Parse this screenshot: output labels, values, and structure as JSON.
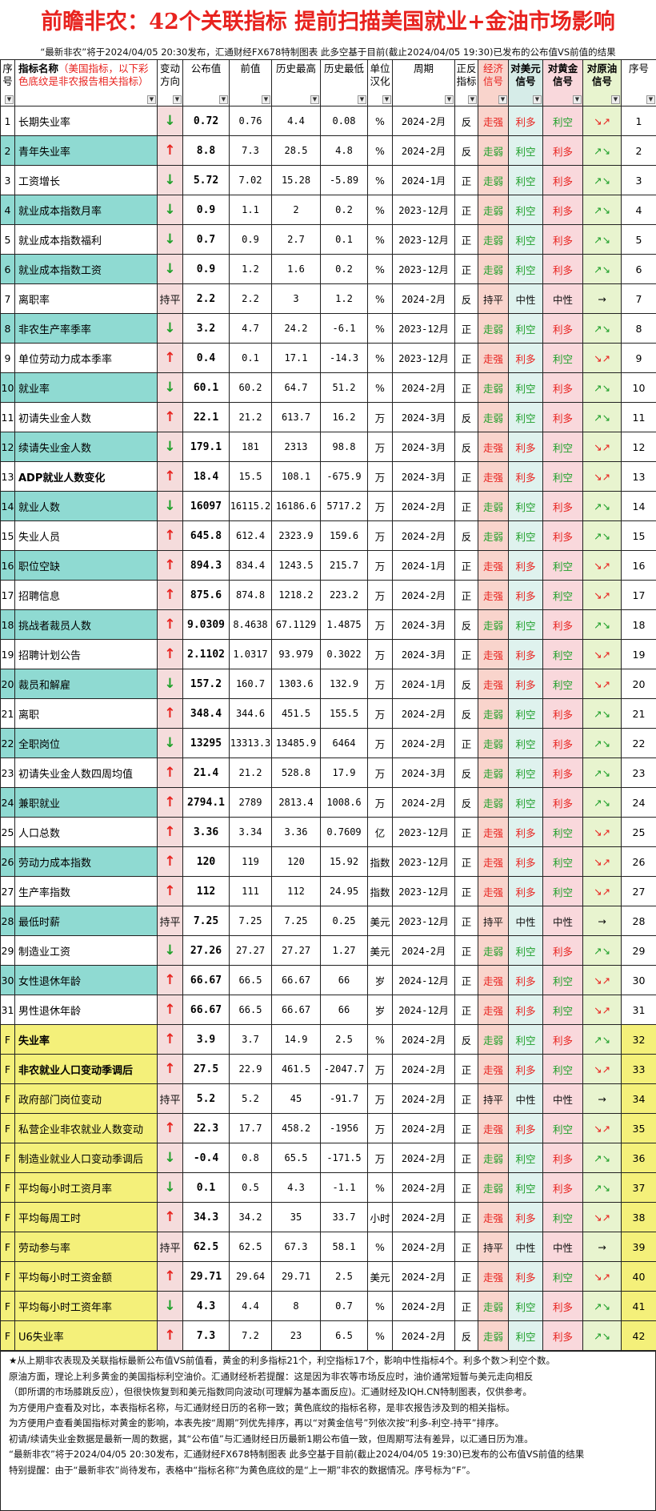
{
  "title": "前瞻非农：42个关联指标  提前扫描美国就业+金油市场影响",
  "subtitle": "“最新非农”将于2024/04/05 20:30发布，汇通财经FX678特制图表 此多空基于目前(截止2024/04/05 19:30)已发布的公布值VS前值的结果",
  "headers": {
    "seq": "序号",
    "name": "指标名称",
    "name_sub": "（美国指标，以下彩色底纹是非农报告相关指标）",
    "dir": "变动方向",
    "val": "公布值",
    "prev": "前值",
    "hi": "历史最高",
    "lo": "历史最低",
    "unit": "单位汉化",
    "period": "周期",
    "pn": "正反指标",
    "econ": "经济信号",
    "usd": "对美元信号",
    "gold": "对黄金信号",
    "oil": "对原油信号",
    "seq2": "序号"
  },
  "rows": [
    {
      "seq": "1",
      "name": "长期失业率",
      "dir": "down",
      "val": "0.72",
      "prev": "0.76",
      "hi": "4.4",
      "lo": "0.08",
      "unit": "%",
      "period": "2024-2月",
      "pn": "反",
      "econ": "走强",
      "usd": "利多",
      "gold": "利空",
      "oil": "↘↗",
      "n": "1"
    },
    {
      "seq": "2",
      "name": "青年失业率",
      "dir": "up",
      "val": "8.8",
      "prev": "7.3",
      "hi": "28.5",
      "lo": "4.8",
      "unit": "%",
      "period": "2024-2月",
      "pn": "反",
      "econ": "走弱",
      "usd": "利空",
      "gold": "利多",
      "oil": "↗↘",
      "n": "2"
    },
    {
      "seq": "3",
      "name": "工资增长",
      "dir": "down",
      "val": "5.72",
      "prev": "7.02",
      "hi": "15.28",
      "lo": "-5.89",
      "unit": "%",
      "period": "2024-1月",
      "pn": "正",
      "econ": "走弱",
      "usd": "利空",
      "gold": "利多",
      "oil": "↗↘",
      "n": "3"
    },
    {
      "seq": "4",
      "name": "就业成本指数月率",
      "dir": "down",
      "val": "0.9",
      "prev": "1.1",
      "hi": "2",
      "lo": "0.2",
      "unit": "%",
      "period": "2023-12月",
      "pn": "正",
      "econ": "走弱",
      "usd": "利空",
      "gold": "利多",
      "oil": "↗↘",
      "n": "4"
    },
    {
      "seq": "5",
      "name": "就业成本指数福利",
      "dir": "down",
      "val": "0.7",
      "prev": "0.9",
      "hi": "2.7",
      "lo": "0.1",
      "unit": "%",
      "period": "2023-12月",
      "pn": "正",
      "econ": "走弱",
      "usd": "利空",
      "gold": "利多",
      "oil": "↗↘",
      "n": "5"
    },
    {
      "seq": "6",
      "name": "就业成本指数工资",
      "dir": "down",
      "val": "0.9",
      "prev": "1.2",
      "hi": "1.6",
      "lo": "0.2",
      "unit": "%",
      "period": "2023-12月",
      "pn": "正",
      "econ": "走弱",
      "usd": "利空",
      "gold": "利多",
      "oil": "↗↘",
      "n": "6"
    },
    {
      "seq": "7",
      "name": "离职率",
      "dir": "flat",
      "val": "2.2",
      "prev": "2.2",
      "hi": "3",
      "lo": "1.2",
      "unit": "%",
      "period": "2024-2月",
      "pn": "反",
      "econ": "持平",
      "usd": "中性",
      "gold": "中性",
      "oil": "→",
      "n": "7"
    },
    {
      "seq": "8",
      "name": "非农生产率季率",
      "dir": "down",
      "val": "3.2",
      "prev": "4.7",
      "hi": "24.2",
      "lo": "-6.1",
      "unit": "%",
      "period": "2023-12月",
      "pn": "正",
      "econ": "走弱",
      "usd": "利空",
      "gold": "利多",
      "oil": "↗↘",
      "n": "8"
    },
    {
      "seq": "9",
      "name": "单位劳动力成本季率",
      "dir": "up",
      "val": "0.4",
      "prev": "0.1",
      "hi": "17.1",
      "lo": "-14.3",
      "unit": "%",
      "period": "2023-12月",
      "pn": "正",
      "econ": "走强",
      "usd": "利多",
      "gold": "利空",
      "oil": "↘↗",
      "n": "9"
    },
    {
      "seq": "10",
      "name": "就业率",
      "dir": "down",
      "val": "60.1",
      "prev": "60.2",
      "hi": "64.7",
      "lo": "51.2",
      "unit": "%",
      "period": "2024-2月",
      "pn": "正",
      "econ": "走弱",
      "usd": "利空",
      "gold": "利多",
      "oil": "↗↘",
      "n": "10"
    },
    {
      "seq": "11",
      "name": "初请失业金人数",
      "dir": "up",
      "val": "22.1",
      "prev": "21.2",
      "hi": "613.7",
      "lo": "16.2",
      "unit": "万",
      "period": "2024-3月",
      "pn": "反",
      "econ": "走弱",
      "usd": "利空",
      "gold": "利多",
      "oil": "↗↘",
      "n": "11"
    },
    {
      "seq": "12",
      "name": "续请失业金人数",
      "dir": "down",
      "val": "179.1",
      "prev": "181",
      "hi": "2313",
      "lo": "98.8",
      "unit": "万",
      "period": "2024-3月",
      "pn": "反",
      "econ": "走强",
      "usd": "利多",
      "gold": "利空",
      "oil": "↘↗",
      "n": "12"
    },
    {
      "seq": "13",
      "name": "ADP就业人数变化",
      "dir": "up",
      "val": "18.4",
      "prev": "15.5",
      "hi": "108.1",
      "lo": "-675.9",
      "unit": "万",
      "period": "2024-3月",
      "pn": "正",
      "econ": "走强",
      "usd": "利多",
      "gold": "利空",
      "oil": "↘↗",
      "n": "13",
      "bold": true
    },
    {
      "seq": "14",
      "name": "就业人数",
      "dir": "down",
      "val": "16097",
      "prev": "16115.2",
      "hi": "16186.6",
      "lo": "5717.2",
      "unit": "万",
      "period": "2024-2月",
      "pn": "正",
      "econ": "走弱",
      "usd": "利空",
      "gold": "利多",
      "oil": "↗↘",
      "n": "14"
    },
    {
      "seq": "15",
      "name": "失业人员",
      "dir": "up",
      "val": "645.8",
      "prev": "612.4",
      "hi": "2323.9",
      "lo": "159.6",
      "unit": "万",
      "period": "2024-2月",
      "pn": "反",
      "econ": "走弱",
      "usd": "利空",
      "gold": "利多",
      "oil": "↗↘",
      "n": "15"
    },
    {
      "seq": "16",
      "name": "职位空缺",
      "dir": "up",
      "val": "894.3",
      "prev": "834.4",
      "hi": "1243.5",
      "lo": "215.7",
      "unit": "万",
      "period": "2024-1月",
      "pn": "正",
      "econ": "走强",
      "usd": "利多",
      "gold": "利空",
      "oil": "↘↗",
      "n": "16"
    },
    {
      "seq": "17",
      "name": "招聘信息",
      "dir": "up",
      "val": "875.6",
      "prev": "874.8",
      "hi": "1218.2",
      "lo": "223.2",
      "unit": "万",
      "period": "2024-2月",
      "pn": "正",
      "econ": "走强",
      "usd": "利多",
      "gold": "利空",
      "oil": "↘↗",
      "n": "17"
    },
    {
      "seq": "18",
      "name": "挑战者裁员人数",
      "dir": "up",
      "val": "9.0309",
      "prev": "8.4638",
      "hi": "67.1129",
      "lo": "1.4875",
      "unit": "万",
      "period": "2024-3月",
      "pn": "反",
      "econ": "走弱",
      "usd": "利空",
      "gold": "利多",
      "oil": "↗↘",
      "n": "18"
    },
    {
      "seq": "19",
      "name": "招聘计划公告",
      "dir": "up",
      "val": "2.1102",
      "prev": "1.0317",
      "hi": "93.979",
      "lo": "0.3022",
      "unit": "万",
      "period": "2024-3月",
      "pn": "正",
      "econ": "走强",
      "usd": "利多",
      "gold": "利空",
      "oil": "↘↗",
      "n": "19"
    },
    {
      "seq": "20",
      "name": "裁员和解雇",
      "dir": "down",
      "val": "157.2",
      "prev": "160.7",
      "hi": "1303.6",
      "lo": "132.9",
      "unit": "万",
      "period": "2024-1月",
      "pn": "反",
      "econ": "走强",
      "usd": "利多",
      "gold": "利空",
      "oil": "↘↗",
      "n": "20"
    },
    {
      "seq": "21",
      "name": "离职",
      "dir": "up",
      "val": "348.4",
      "prev": "344.6",
      "hi": "451.5",
      "lo": "155.5",
      "unit": "万",
      "period": "2024-2月",
      "pn": "反",
      "econ": "走弱",
      "usd": "利空",
      "gold": "利多",
      "oil": "↗↘",
      "n": "21"
    },
    {
      "seq": "22",
      "name": "全职岗位",
      "dir": "down",
      "val": "13295",
      "prev": "13313.3",
      "hi": "13485.9",
      "lo": "6464",
      "unit": "万",
      "period": "2024-2月",
      "pn": "正",
      "econ": "走弱",
      "usd": "利空",
      "gold": "利多",
      "oil": "↗↘",
      "n": "22"
    },
    {
      "seq": "23",
      "name": "初请失业金人数四周均值",
      "dir": "up",
      "val": "21.4",
      "prev": "21.2",
      "hi": "528.8",
      "lo": "17.9",
      "unit": "万",
      "period": "2024-3月",
      "pn": "反",
      "econ": "走弱",
      "usd": "利空",
      "gold": "利多",
      "oil": "↗↘",
      "n": "23"
    },
    {
      "seq": "24",
      "name": "兼职就业",
      "dir": "up",
      "val": "2794.1",
      "prev": "2789",
      "hi": "2813.4",
      "lo": "1008.6",
      "unit": "万",
      "period": "2024-2月",
      "pn": "反",
      "econ": "走弱",
      "usd": "利空",
      "gold": "利多",
      "oil": "↗↘",
      "n": "24"
    },
    {
      "seq": "25",
      "name": "人口总数",
      "dir": "up",
      "val": "3.36",
      "prev": "3.34",
      "hi": "3.36",
      "lo": "0.7609",
      "unit": "亿",
      "period": "2023-12月",
      "pn": "正",
      "econ": "走强",
      "usd": "利多",
      "gold": "利空",
      "oil": "↘↗",
      "n": "25"
    },
    {
      "seq": "26",
      "name": "劳动力成本指数",
      "dir": "up",
      "val": "120",
      "prev": "119",
      "hi": "120",
      "lo": "15.92",
      "unit": "指数",
      "period": "2023-12月",
      "pn": "正",
      "econ": "走强",
      "usd": "利多",
      "gold": "利空",
      "oil": "↘↗",
      "n": "26"
    },
    {
      "seq": "27",
      "name": "生产率指数",
      "dir": "up",
      "val": "112",
      "prev": "111",
      "hi": "112",
      "lo": "24.95",
      "unit": "指数",
      "period": "2023-12月",
      "pn": "正",
      "econ": "走强",
      "usd": "利多",
      "gold": "利空",
      "oil": "↘↗",
      "n": "27"
    },
    {
      "seq": "28",
      "name": "最低时薪",
      "dir": "flat",
      "val": "7.25",
      "prev": "7.25",
      "hi": "7.25",
      "lo": "0.25",
      "unit": "美元",
      "period": "2023-12月",
      "pn": "正",
      "econ": "持平",
      "usd": "中性",
      "gold": "中性",
      "oil": "→",
      "n": "28"
    },
    {
      "seq": "29",
      "name": "制造业工资",
      "dir": "down",
      "val": "27.26",
      "prev": "27.27",
      "hi": "27.27",
      "lo": "1.27",
      "unit": "美元",
      "period": "2024-2月",
      "pn": "正",
      "econ": "走弱",
      "usd": "利空",
      "gold": "利多",
      "oil": "↗↘",
      "n": "29"
    },
    {
      "seq": "30",
      "name": "女性退休年龄",
      "dir": "up",
      "val": "66.67",
      "prev": "66.5",
      "hi": "66.67",
      "lo": "66",
      "unit": "岁",
      "period": "2024-12月",
      "pn": "正",
      "econ": "走强",
      "usd": "利多",
      "gold": "利空",
      "oil": "↘↗",
      "n": "30"
    },
    {
      "seq": "31",
      "name": "男性退休年龄",
      "dir": "up",
      "val": "66.67",
      "prev": "66.5",
      "hi": "66.67",
      "lo": "66",
      "unit": "岁",
      "period": "2024-12月",
      "pn": "正",
      "econ": "走强",
      "usd": "利多",
      "gold": "利空",
      "oil": "↘↗",
      "n": "31"
    },
    {
      "seq": "F",
      "name": "失业率",
      "dir": "up",
      "val": "3.9",
      "prev": "3.7",
      "hi": "14.9",
      "lo": "2.5",
      "unit": "%",
      "period": "2024-2月",
      "pn": "反",
      "econ": "走弱",
      "usd": "利空",
      "gold": "利多",
      "oil": "↗↘",
      "n": "32",
      "nf": true,
      "bold": true
    },
    {
      "seq": "F",
      "name": "非农就业人口变动季调后",
      "dir": "up",
      "val": "27.5",
      "prev": "22.9",
      "hi": "461.5",
      "lo": "-2047.7",
      "unit": "万",
      "period": "2024-2月",
      "pn": "正",
      "econ": "走强",
      "usd": "利多",
      "gold": "利空",
      "oil": "↘↗",
      "n": "33",
      "nf": true,
      "bold": true
    },
    {
      "seq": "F",
      "name": "政府部门岗位变动",
      "dir": "flat",
      "val": "5.2",
      "prev": "5.2",
      "hi": "45",
      "lo": "-91.7",
      "unit": "万",
      "period": "2024-2月",
      "pn": "正",
      "econ": "持平",
      "usd": "中性",
      "gold": "中性",
      "oil": "→",
      "n": "34",
      "nf": true
    },
    {
      "seq": "F",
      "name": "私营企业非农就业人数变动",
      "dir": "up",
      "val": "22.3",
      "prev": "17.7",
      "hi": "458.2",
      "lo": "-1956",
      "unit": "万",
      "period": "2024-2月",
      "pn": "正",
      "econ": "走强",
      "usd": "利多",
      "gold": "利空",
      "oil": "↘↗",
      "n": "35",
      "nf": true
    },
    {
      "seq": "F",
      "name": "制造业就业人口变动季调后",
      "dir": "down",
      "val": "-0.4",
      "prev": "0.8",
      "hi": "65.5",
      "lo": "-171.5",
      "unit": "万",
      "period": "2024-2月",
      "pn": "正",
      "econ": "走弱",
      "usd": "利空",
      "gold": "利多",
      "oil": "↗↘",
      "n": "36",
      "nf": true
    },
    {
      "seq": "F",
      "name": "平均每小时工资月率",
      "dir": "down",
      "val": "0.1",
      "prev": "0.5",
      "hi": "4.3",
      "lo": "-1.1",
      "unit": "%",
      "period": "2024-2月",
      "pn": "正",
      "econ": "走弱",
      "usd": "利空",
      "gold": "利多",
      "oil": "↗↘",
      "n": "37",
      "nf": true
    },
    {
      "seq": "F",
      "name": "平均每周工时",
      "dir": "up",
      "val": "34.3",
      "prev": "34.2",
      "hi": "35",
      "lo": "33.7",
      "unit": "小时",
      "period": "2024-2月",
      "pn": "正",
      "econ": "走强",
      "usd": "利多",
      "gold": "利空",
      "oil": "↘↗",
      "n": "38",
      "nf": true
    },
    {
      "seq": "F",
      "name": "劳动参与率",
      "dir": "flat",
      "val": "62.5",
      "prev": "62.5",
      "hi": "67.3",
      "lo": "58.1",
      "unit": "%",
      "period": "2024-2月",
      "pn": "正",
      "econ": "持平",
      "usd": "中性",
      "gold": "中性",
      "oil": "→",
      "n": "39",
      "nf": true
    },
    {
      "seq": "F",
      "name": "平均每小时工资金额",
      "dir": "up",
      "val": "29.71",
      "prev": "29.64",
      "hi": "29.71",
      "lo": "2.5",
      "unit": "美元",
      "period": "2024-2月",
      "pn": "正",
      "econ": "走强",
      "usd": "利多",
      "gold": "利空",
      "oil": "↘↗",
      "n": "40",
      "nf": true
    },
    {
      "seq": "F",
      "name": "平均每小时工资年率",
      "dir": "down",
      "val": "4.3",
      "prev": "4.4",
      "hi": "8",
      "lo": "0.7",
      "unit": "%",
      "period": "2024-2月",
      "pn": "正",
      "econ": "走弱",
      "usd": "利空",
      "gold": "利多",
      "oil": "↗↘",
      "n": "41",
      "nf": true
    },
    {
      "seq": "F",
      "name": "U6失业率",
      "dir": "up",
      "val": "7.3",
      "prev": "7.2",
      "hi": "23",
      "lo": "6.5",
      "unit": "%",
      "period": "2024-2月",
      "pn": "反",
      "econ": "走弱",
      "usd": "利空",
      "gold": "利多",
      "oil": "↗↘",
      "n": "42",
      "nf": true
    }
  ],
  "dir_symbols": {
    "up": "↑",
    "down": "↓",
    "flat": "持平"
  },
  "notes": [
    "★从上期非农表现及关联指标最新公布值VS前值看，黄金的利多指标21个，利空指标17个，影响中性指标4个。利多个数＞利空个数。",
    "原油方面，理论上利多黄金的美国指标利空油价。汇通财经析若提醒：这是因为非农等市场反应时，油价通常短暂与美元走向相反",
    "（即所谓的市场膝跳反应），但很快恢复到和美元指数同向波动(可理解为基本面反应)。汇通财经及IQH.CN特制图表，仅供参考。",
    "为方便用户查看及对比，本表指标名称，与汇通财经日历的名称一致；黄色底纹的指标名称，是非农报告涉及到的相关指标。",
    "为方便用户查看美国指标对黄金的影响，本表先按“周期”列优先排序，再以“对黄金信号”列依次按“利多-利空-持平”排序。",
    "初请/续请失业金数据是最新一周的数据，其“公布值”与汇通财经日历最新1期公布值一致，但周期写法有差异，以汇通日历为准。",
    "“最新非农”将于2024/04/05 20:30发布，汇通财经FX678特制图表 此多空基于目前(截止2024/04/05 19:30)已发布的公布值VS前值的结果",
    "特别提醒：由于“最新非农”尚待发布，表格中“指标名称”为黄色底纹的是“上一期”非农的数据情况。序号标为“F”。"
  ]
}
